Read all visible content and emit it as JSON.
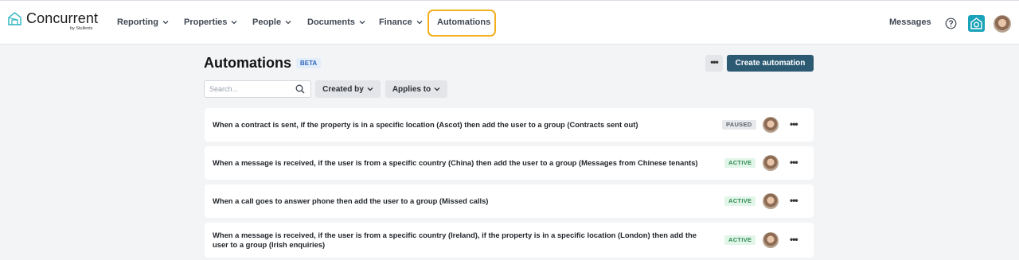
{
  "brand": {
    "name": "Concurrent",
    "sub": "by Stullents"
  },
  "nav": {
    "items": [
      {
        "label": "Reporting",
        "has_menu": true
      },
      {
        "label": "Properties",
        "has_menu": true
      },
      {
        "label": "People",
        "has_menu": true
      },
      {
        "label": "Documents",
        "has_menu": true
      },
      {
        "label": "Finance",
        "has_menu": true
      },
      {
        "label": "Automations",
        "has_menu": false,
        "active": true
      }
    ],
    "messages_label": "Messages",
    "icons": [
      "help-icon",
      "brand-home-icon",
      "user-avatar"
    ],
    "highlight_color": "#f2b01e"
  },
  "page": {
    "title": "Automations",
    "badge": "BETA",
    "more_label": "•••",
    "create_label": "Create automation",
    "accent_color": "#2c5a73"
  },
  "filters": {
    "search_placeholder": "Search...",
    "created_by_label": "Created by",
    "applies_to_label": "Applies to"
  },
  "automations": [
    {
      "text_line1": "When a contract is sent, if the property is in a specific location (Ascot) then add the user to a group (Contracts sent out)",
      "text_line2": "",
      "status": "PAUSED",
      "status_kind": "paused",
      "more": "•••"
    },
    {
      "text_line1": "When a message is received, if the user is from a specific country (China) then add the user to a group (Messages from Chinese tenants)",
      "text_line2": "",
      "status": "ACTIVE",
      "status_kind": "active",
      "more": "•••"
    },
    {
      "text_line1": "When a call goes to answer phone then add the user to a group (Missed calls)",
      "text_line2": "",
      "status": "ACTIVE",
      "status_kind": "active",
      "more": "•••"
    },
    {
      "text_line1": "When a message is received, if the user is from a specific country (Ireland), if the property is in a specific location (London) then add the",
      "text_line2": "user to a group (Irish enquiries)",
      "status": "ACTIVE",
      "status_kind": "active",
      "more": "•••"
    }
  ]
}
